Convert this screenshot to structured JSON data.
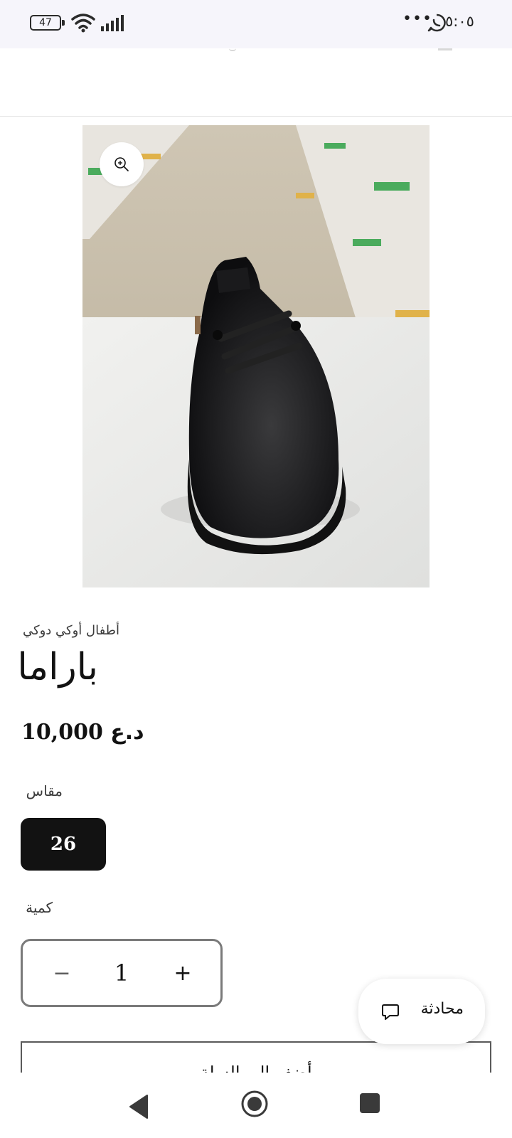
{
  "status_bar": {
    "time": "٥:٠٥",
    "battery": "47",
    "overflow": "•••",
    "icons": [
      "battery-icon",
      "wifi-icon",
      "signal-icon",
      "whatsapp-icon"
    ]
  },
  "product": {
    "image_alt": "black kids leather shoe",
    "vendor": "أطفال أوكي دوكي",
    "title": "باراما",
    "price_amount": "10,000",
    "price_currency": "د.ع"
  },
  "options": {
    "size_label": "مقاس",
    "sizes": [
      "26"
    ],
    "selected_size": "26"
  },
  "quantity": {
    "label": "كمية",
    "value": "1",
    "minus": "−",
    "plus": "+"
  },
  "add_to_cart": {
    "label": "أضف إلى السلة"
  },
  "chat": {
    "label": "محادثة"
  },
  "colors": {
    "text": "#121212",
    "selected_bg": "#121212",
    "status_bg": "#f6f5fb"
  }
}
